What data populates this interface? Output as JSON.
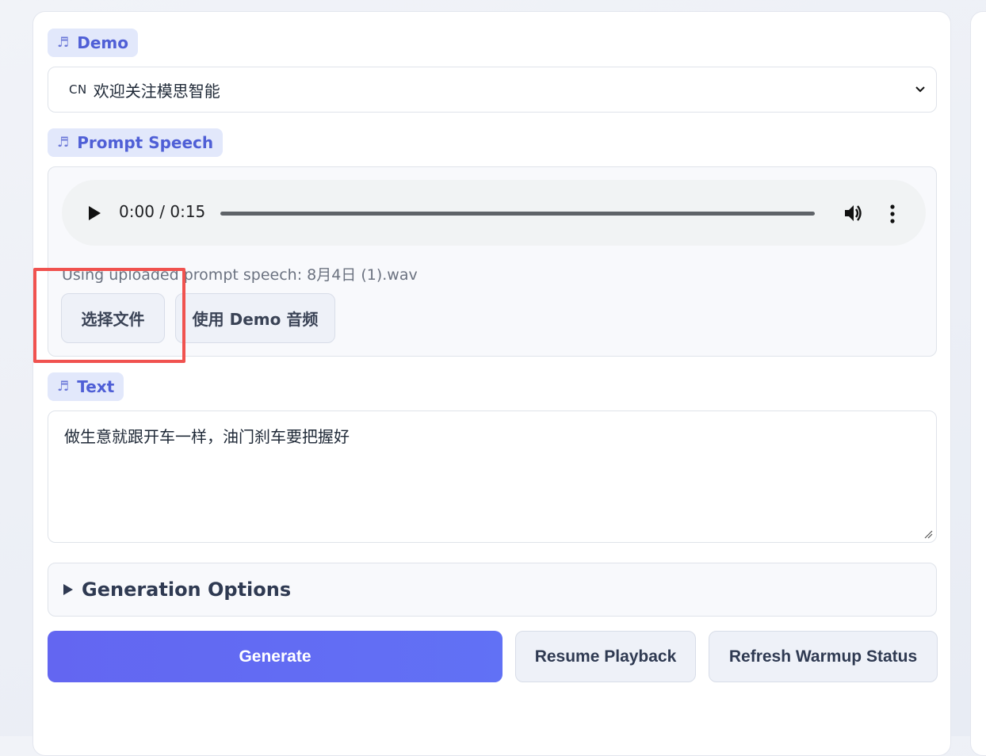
{
  "demo": {
    "label": "Demo",
    "selected_flag": "CN",
    "selected_value": "欢迎关注模思智能"
  },
  "prompt_speech": {
    "label": "Prompt Speech",
    "player": {
      "time": "0:00 / 0:15",
      "progress": 0
    },
    "status": "Using uploaded prompt speech: 8月4日 (1).wav",
    "choose_file_label": "选择文件",
    "use_demo_label": "使用 Demo 音频"
  },
  "text": {
    "label": "Text",
    "value": "做生意就跟开车一样，油门刹车要把握好"
  },
  "generation_options": {
    "label": "Generation Options"
  },
  "actions": {
    "generate": "Generate",
    "resume": "Resume Playback",
    "refresh": "Refresh Warmup Status"
  },
  "colors": {
    "accent": "#6366f1",
    "chip_bg": "#e2e8fb",
    "chip_text": "#4f5fd6",
    "highlight": "#f0524f"
  },
  "icons": [
    "music-note-icon",
    "chevron-down-icon",
    "play-icon",
    "volume-icon",
    "more-vert-icon",
    "resize-grip-icon",
    "triangle-right-icon"
  ]
}
